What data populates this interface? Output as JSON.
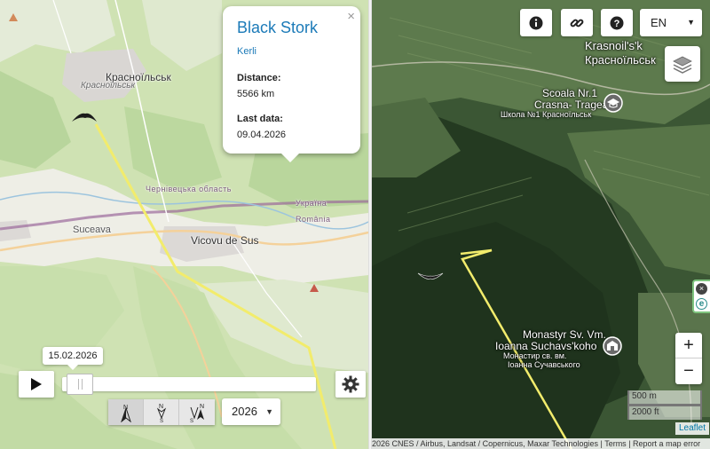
{
  "popup": {
    "title": "Black Stork",
    "name": "Kerli",
    "distance_label": "Distance:",
    "distance_value": "5566 km",
    "lastdata_label": "Last data:",
    "lastdata_value": "09.04.2026",
    "close_glyph": "×"
  },
  "left_map": {
    "labels": {
      "krasnoilsk": "Красноїльськ",
      "krasnoilsk_sub": "Красноїльськ",
      "oblast": "Чернівецька область",
      "ukraina": "Україна",
      "romania": "România",
      "suceava": "Suceava",
      "vicovu": "Vicovu de Sus"
    },
    "route_color": "#f2ec6c",
    "border_color": "#9b6a9b"
  },
  "timeline": {
    "date_tooltip": "15.02.2026",
    "play_icon": "play-icon",
    "settings_icon": "gear-icon",
    "position": 0.02
  },
  "direction_buttons": [
    {
      "name": "north",
      "sub": ""
    },
    {
      "name": "south",
      "sub": "S"
    },
    {
      "name": "north-south",
      "sub": "S"
    }
  ],
  "year_select": {
    "value": "2026"
  },
  "right_map": {
    "labels": {
      "krasnoilsk_latin": "Krasnoil's'k",
      "krasnoilsk_cyr": "Красноїльськ",
      "school_1": "Scoala Nr.1",
      "school_2": "Crasna- Tragean",
      "school_3": "Школа №1 Красноїльськ",
      "monastery_1": "Monastyr Sv. Vm.",
      "monastery_2": "Ioanna Suchavs'koho",
      "monastery_3": "Монастир св. вм.",
      "monastery_4": "Іоанна Сучавського"
    },
    "toolbar": {
      "info_icon": "info-icon",
      "link_icon": "link-icon",
      "help_icon": "help-icon",
      "language": "EN"
    },
    "side_tab": {
      "close": "×",
      "e": "e"
    },
    "zoom_in": "+",
    "zoom_out": "−",
    "scale_metric": "500 m",
    "scale_imperial": "2000 ft",
    "leaflet_link": "Leaflet",
    "attribution": "2026 CNES / Airbus, Landsat / Copernicus, Maxar Technologies",
    "terms": "Terms",
    "report": "Report a map error"
  }
}
